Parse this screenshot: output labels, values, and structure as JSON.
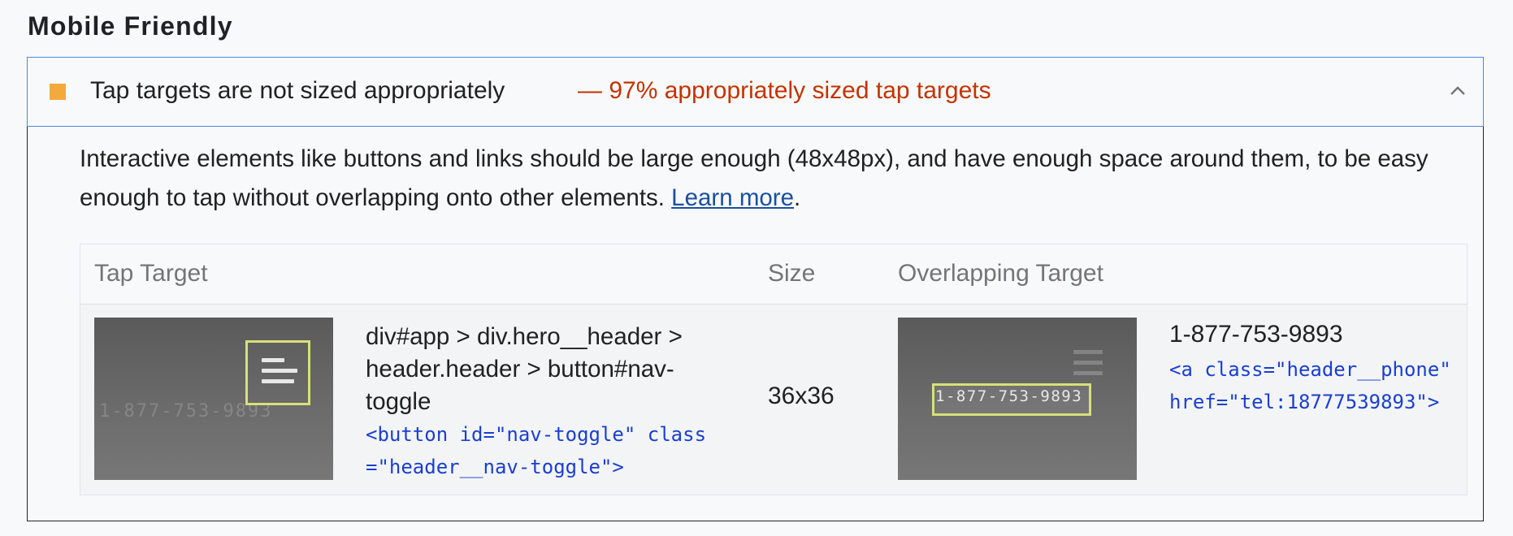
{
  "section": {
    "title": "Mobile Friendly"
  },
  "audit": {
    "title": "Tap targets are not sized appropriately",
    "display_value": "— 97% appropriately sized tap targets",
    "status_color": "#f4a93b",
    "description": "Interactive elements like buttons and links should be large enough (48x48px), and have enough space around them, to be easy enough to tap without overlapping onto other elements. ",
    "learn_more": "Learn more",
    "period": "."
  },
  "table": {
    "headers": {
      "tap_target": "Tap Target",
      "size": "Size",
      "overlapping_target": "Overlapping Target"
    },
    "rows": [
      {
        "node_path": "div#app > div.hero__header > header.header > button#nav-toggle",
        "snippet": "<button id=\"nav-toggle\" class=\"header__nav-toggle\">",
        "size": "36x36",
        "overlap_label": "1-877-753-9893",
        "overlap_snippet": "<a class=\"header__phone\" href=\"tel:18777539893\">",
        "thumb_phone_text": "1-877-753-9893"
      }
    ]
  }
}
